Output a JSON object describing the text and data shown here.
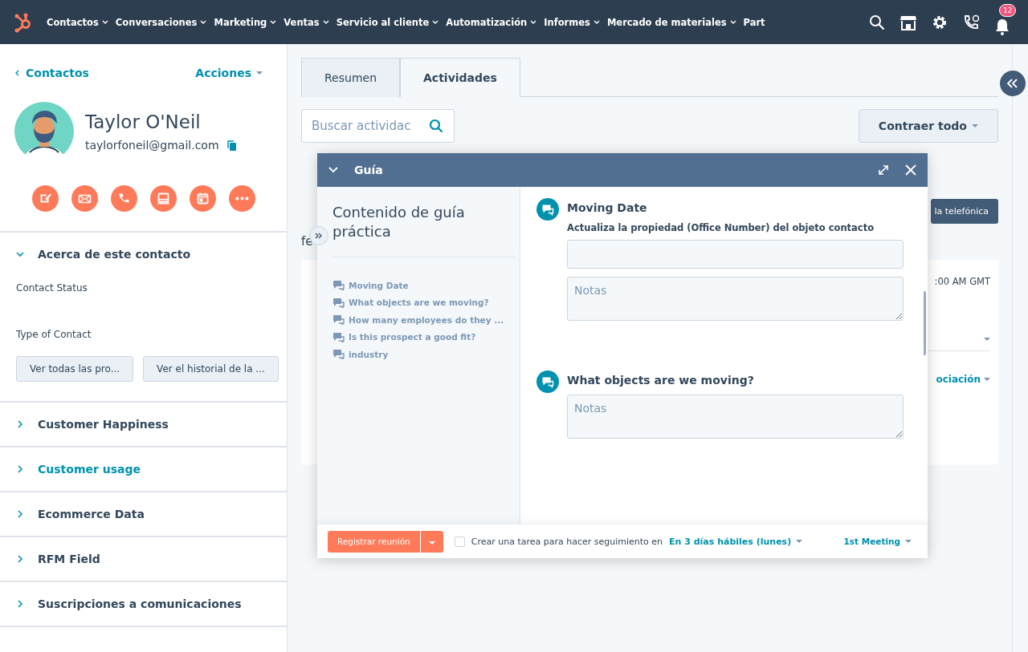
{
  "nav": {
    "items": [
      {
        "label": "Contactos"
      },
      {
        "label": "Conversaciones"
      },
      {
        "label": "Marketing"
      },
      {
        "label": "Ventas"
      },
      {
        "label": "Servicio al cliente"
      },
      {
        "label": "Automatización"
      },
      {
        "label": "Informes"
      },
      {
        "label": "Mercado de materiales"
      },
      {
        "label": "Part"
      }
    ],
    "notifications": "12"
  },
  "sidebar": {
    "back": "Contactos",
    "actions": "Acciones",
    "name": "Taylor O'Neil",
    "email": "taylorfoneil@gmail.com",
    "sections": [
      {
        "title": "Acerca de este contacto",
        "expanded": true,
        "hovered": false,
        "fields": [
          "Contact Status",
          "Type of Contact"
        ],
        "buttons": [
          "Ver todas las pro...",
          "Ver el historial de la ..."
        ]
      },
      {
        "title": "Customer Happiness",
        "expanded": false,
        "hovered": false
      },
      {
        "title": "Customer usage",
        "expanded": false,
        "hovered": true
      },
      {
        "title": "Ecommerce Data",
        "expanded": false,
        "hovered": false
      },
      {
        "title": "RFM Field",
        "expanded": false,
        "hovered": false
      },
      {
        "title": "Suscripciones a comunicaciones",
        "expanded": false,
        "hovered": false
      }
    ]
  },
  "main": {
    "tabs": [
      {
        "label": "Resumen",
        "selected": false
      },
      {
        "label": "Actividades",
        "selected": true
      }
    ],
    "search": {
      "placeholder": "Buscar actividac"
    },
    "collapse_all": "Contraer todo",
    "call_button": "la telefónica",
    "partial_text": "fe",
    "card_time": ":00 AM GMT",
    "card_link": "ociación"
  },
  "guide": {
    "title": "Guía",
    "outline_title": "Contenido de guía práctica",
    "outline": [
      "Moving Date",
      "What objects are we moving?",
      "How many employees do they ...",
      "Is this prospect a good fit?",
      "industry"
    ],
    "questions": [
      {
        "title": "Moving Date",
        "property": "Actualiza la propiedad (Office Number) del objeto contacto",
        "placeholder": "Notas"
      },
      {
        "title": "What objects are we moving?",
        "placeholder": "Notas"
      }
    ],
    "footer": {
      "button": "Registrar reunión",
      "followup_checked": false,
      "followup": "Crear una tarea para hacer seguimiento en",
      "followup_when": "En 3 días hábiles (lunes)",
      "meeting_type": "1st Meeting"
    }
  }
}
